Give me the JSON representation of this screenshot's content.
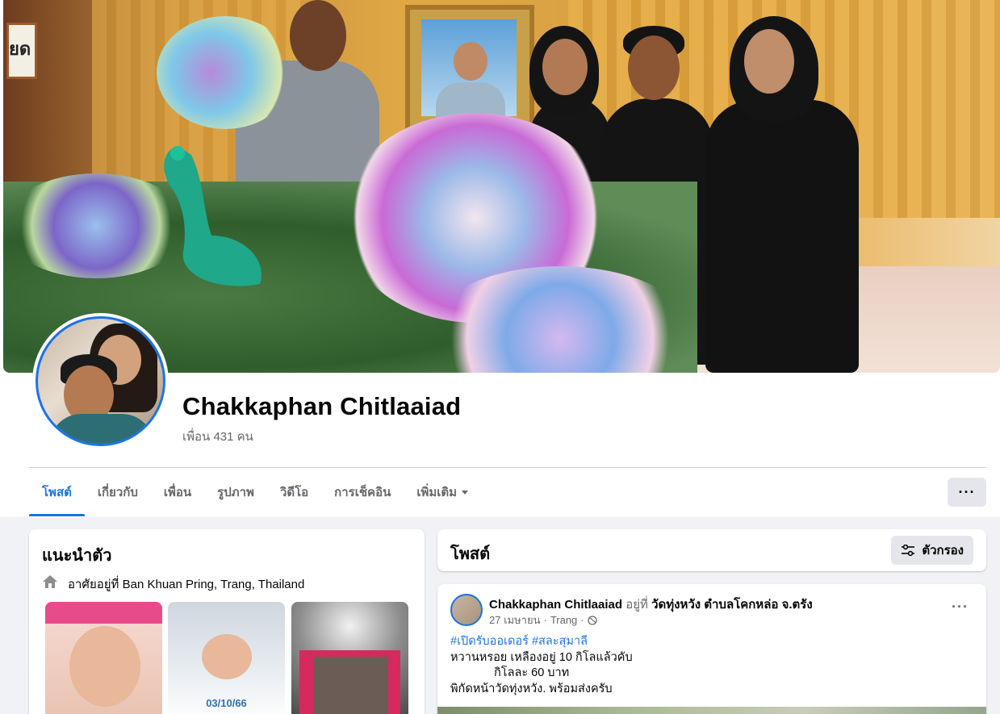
{
  "profile": {
    "name": "Chakkaphan Chitlaaiad",
    "friends_text": "เพื่อน 431 คน"
  },
  "tabs": [
    {
      "label": "โพสต์",
      "active": true
    },
    {
      "label": "เกี่ยวกับ",
      "active": false
    },
    {
      "label": "เพื่อน",
      "active": false
    },
    {
      "label": "รูปภาพ",
      "active": false
    },
    {
      "label": "วิดีโอ",
      "active": false
    },
    {
      "label": "การเช็คอิน",
      "active": false
    },
    {
      "label": "เพิ่มเติม",
      "active": false
    }
  ],
  "more_button": "···",
  "intro": {
    "title": "แนะนำตัว",
    "lives_prefix": "อาศัยอยู่ที่ ",
    "lives_place": "Ban Khuan Pring, Trang, Thailand",
    "photos": [
      {
        "label": ""
      },
      {
        "label": "03/10/66"
      },
      {
        "label": ""
      }
    ]
  },
  "posts_header": {
    "title": "โพสต์",
    "filter_label": "ตัวกรอง"
  },
  "post": {
    "author": "Chakkaphan Chitlaaiad",
    "at_text": " อยู่ที่ ",
    "place": "วัดทุ่งหวัง ตำบลโคกหล่อ จ.ตรัง",
    "date": "27 เมษายน",
    "separator": " · ",
    "location": "Trang",
    "hashtags": "#เปิดรับออเดอร์  #สละสุมาลี",
    "line1": "หวานหรอย   เหลืองอยู่ 10 กิโลแล้วคับ",
    "line2": "กิโลละ 60 บาท",
    "line3": "พิกัดหน้าวัดทุ่งหวัง. พร้อมส่งครับ"
  },
  "cover_sign_text": "ยด",
  "colors": {
    "accent": "#1b74e4",
    "background": "#f0f2f5",
    "secondary_text": "#65676b"
  }
}
